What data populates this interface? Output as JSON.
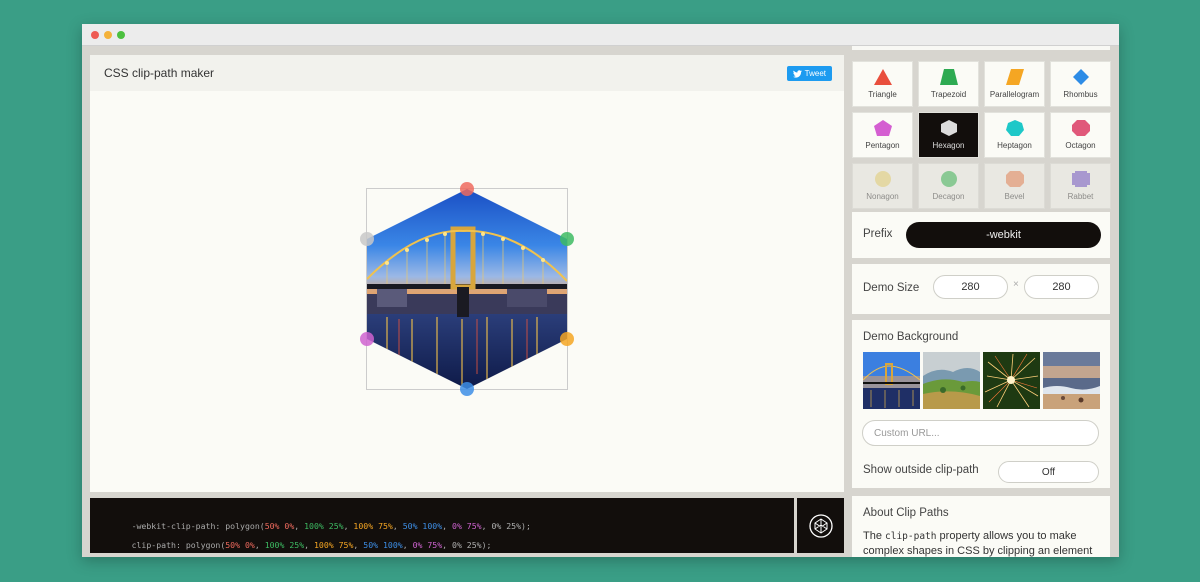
{
  "app": {
    "title": "CSS clip-path maker",
    "tweet_label": "Tweet"
  },
  "shapes": [
    {
      "label": "Triangle",
      "color": "#e94f3d",
      "icon": "triangle-icon"
    },
    {
      "label": "Trapezoid",
      "color": "#2eaa52",
      "icon": "trapezoid-icon"
    },
    {
      "label": "Parallelogram",
      "color": "#f5a623",
      "icon": "parallelogram-icon"
    },
    {
      "label": "Rhombus",
      "color": "#2d8ce6",
      "icon": "rhombus-icon"
    },
    {
      "label": "Pentagon",
      "color": "#d45ed1",
      "icon": "pentagon-icon"
    },
    {
      "label": "Hexagon",
      "color": "#dcdcdc",
      "icon": "hexagon-icon",
      "active": true
    },
    {
      "label": "Heptagon",
      "color": "#1ec8c8",
      "icon": "heptagon-icon"
    },
    {
      "label": "Octagon",
      "color": "#e0587a",
      "icon": "octagon-icon"
    },
    {
      "label": "Nonagon",
      "color": "#f1dc7a",
      "icon": "nonagon-icon"
    },
    {
      "label": "Decagon",
      "color": "#3fbf5a",
      "icon": "decagon-icon"
    },
    {
      "label": "Bevel",
      "color": "#f28a5a",
      "icon": "bevel-icon"
    },
    {
      "label": "Rabbet",
      "color": "#7a5ccf",
      "icon": "rabbet-icon"
    }
  ],
  "prefix": {
    "label": "Prefix",
    "value": "-webkit"
  },
  "demo_size": {
    "label": "Demo Size",
    "width": "280",
    "height": "280",
    "separator": "×"
  },
  "demo_background": {
    "label": "Demo Background",
    "thumbs": [
      "bridge-night",
      "green-hills",
      "sparkler",
      "beach-sunset"
    ],
    "custom_url_placeholder": "Custom URL..."
  },
  "outside_clip": {
    "label": "Show outside clip-path",
    "value": "Off"
  },
  "about": {
    "title": "About Clip Paths",
    "text_before": "The ",
    "code": "clip-path",
    "text_after": " property allows you to make complex shapes in CSS by clipping an element to"
  },
  "code": {
    "line1_prop": "-webkit-clip-path:",
    "line2_prop": "clip-path:",
    "fn_open": "polygon(",
    "fn_close": ");",
    "points": [
      {
        "text": "50% 0%",
        "color": "#ef6a5e"
      },
      {
        "text": "100% 25%",
        "color": "#3dbb63"
      },
      {
        "text": "100% 75%",
        "color": "#f5a623"
      },
      {
        "text": "50% 100%",
        "color": "#3d8ee6"
      },
      {
        "text": "0% 75%",
        "color": "#cf63d0"
      },
      {
        "text": "0% 25%",
        "color": "#b0b0b0"
      }
    ]
  },
  "handle_colors": [
    "#ef6a5e",
    "#3dbb63",
    "#f5a623",
    "#3d8ee6",
    "#cf63d0",
    "#c8c8c8"
  ]
}
